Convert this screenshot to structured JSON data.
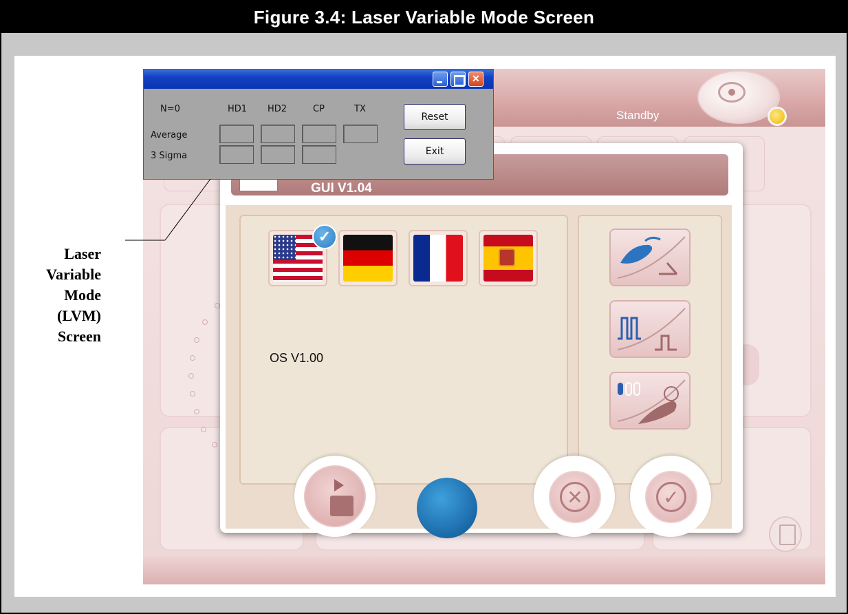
{
  "figure": {
    "caption": "Figure 3.4:  Laser Variable Mode Screen",
    "annotation_lines": [
      "Laser",
      "Variable",
      "Mode",
      "(LVM)",
      "Screen"
    ]
  },
  "app": {
    "status_text": "Standby",
    "logo_icon": "eye-logo-icon",
    "status_led_color": "#f0b800"
  },
  "dialog": {
    "title": "GUI V1.04",
    "os_version": "OS V1.00",
    "languages": [
      {
        "name": "flag-us-icon",
        "selected": true
      },
      {
        "name": "flag-germany-icon",
        "selected": false
      },
      {
        "name": "flag-france-icon",
        "selected": false
      },
      {
        "name": "flag-spain-icon",
        "selected": false
      }
    ],
    "mode_buttons": [
      "handpiece-mode-icon",
      "pulse-mode-icon",
      "treatment-mode-icon"
    ],
    "bottom_buttons": [
      "service-tools-button",
      "blue-button",
      "cancel-button",
      "confirm-button"
    ]
  },
  "lvm_window": {
    "counter": "N=0",
    "columns": [
      "HD1",
      "HD2",
      "CP",
      "TX"
    ],
    "row_labels": [
      "Average",
      "3 Sigma"
    ],
    "reset_label": "Reset",
    "exit_label": "Exit"
  },
  "colors": {
    "accent_blue": "#1b6aa8",
    "title_pink": "#b07a7a",
    "xp_titlebar": "#1241c2"
  }
}
